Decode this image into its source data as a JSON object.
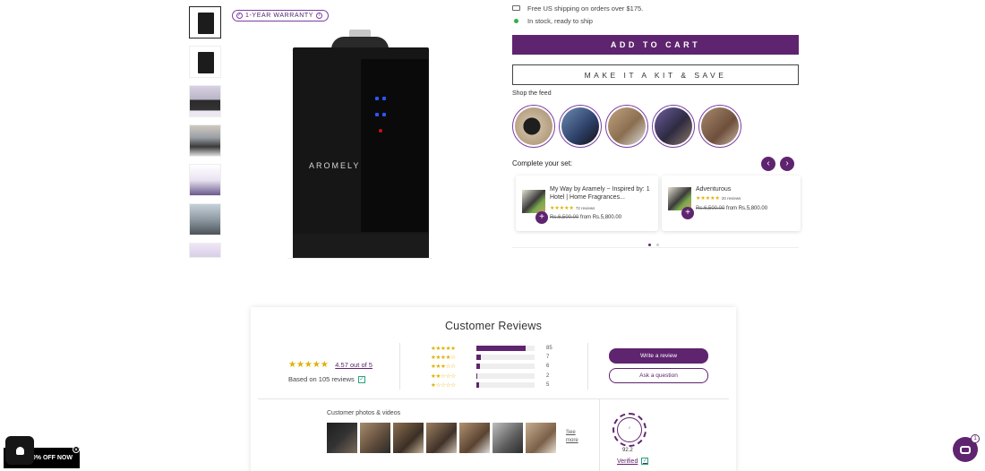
{
  "warranty": {
    "label": "1-YEAR WARRANTY"
  },
  "product": {
    "brand": "AROMELY"
  },
  "shipping": {
    "free_shipping": "Free US shipping on orders over $175.",
    "stock": "In stock, ready to ship"
  },
  "buttons": {
    "add_to_cart": "ADD TO CART",
    "make_kit": "MAKE IT A KIT & SAVE"
  },
  "feed": {
    "label": "Shop the feed"
  },
  "complete_set": {
    "label": "Complete your set:",
    "cards": [
      {
        "title": "My Way by Aramely ~ Inspired by: 1 Hotel | Home Fragrances...",
        "stars": "★★★★★",
        "reviews": "72 reviews",
        "compare_price": "Rs.6,500.00",
        "price": "from Rs.5,800.00"
      },
      {
        "title": "Adventurous",
        "stars": "★★★★★",
        "reviews": "20 reviews",
        "compare_price": "Rs.6,500.00",
        "price": "from Rs.5,800.00"
      }
    ]
  },
  "reviews": {
    "heading": "Customer Reviews",
    "average_stars": "★★★★★",
    "average_text": "4.57 out of 5",
    "based_on": "Based on 105 reviews",
    "distribution": [
      {
        "stars": "★★★★★",
        "count": "85",
        "fraction": 0.85
      },
      {
        "stars": "★★★★☆",
        "count": "7",
        "fraction": 0.07
      },
      {
        "stars": "★★★☆☆",
        "count": "6",
        "fraction": 0.06
      },
      {
        "stars": "★★☆☆☆",
        "count": "2",
        "fraction": 0.02
      },
      {
        "stars": "★☆☆☆☆",
        "count": "5",
        "fraction": 0.05
      }
    ],
    "write_review": "Write a review",
    "ask_question": "Ask a question",
    "photos_label": "Customer photos & videos",
    "see_more": "See more",
    "transparency_score": "92.2",
    "verified": "Verified"
  },
  "promo": {
    "label": "10% OFF NOW"
  },
  "chat": {
    "badge": "1"
  },
  "colors": {
    "accent": "#5f246f",
    "star": "#e2b100"
  }
}
